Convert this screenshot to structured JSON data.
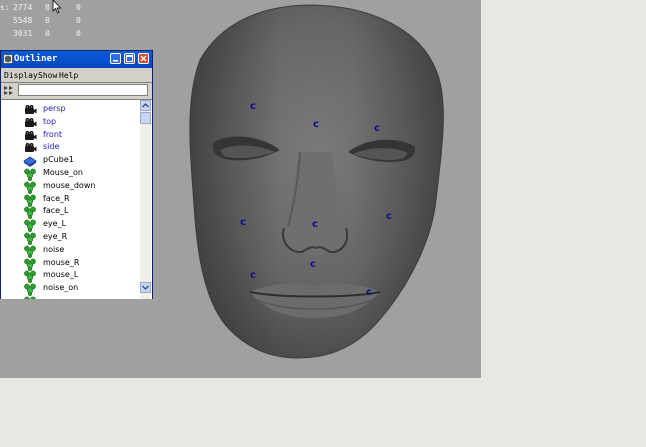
{
  "stats": {
    "rows": [
      [
        "s:",
        "2774",
        "0",
        "0"
      ],
      [
        "",
        "5548",
        "0",
        "0"
      ],
      [
        "",
        "3031",
        "0",
        "0"
      ]
    ]
  },
  "controls": [
    {
      "name": "ctrl-forehead-left",
      "label": "c"
    },
    {
      "name": "ctrl-forehead-center",
      "label": "c"
    },
    {
      "name": "ctrl-forehead-right",
      "label": "c"
    },
    {
      "name": "ctrl-cheek-left",
      "label": "c"
    },
    {
      "name": "ctrl-nose",
      "label": "c"
    },
    {
      "name": "ctrl-cheek-right",
      "label": "c"
    },
    {
      "name": "ctrl-upper-lip",
      "label": "c"
    },
    {
      "name": "ctrl-mouth-corner-left",
      "label": "c"
    },
    {
      "name": "ctrl-mouth-corner-right",
      "label": "c"
    }
  ],
  "outliner": {
    "title": "Outliner",
    "menu": [
      "Display",
      "Show",
      "Help"
    ],
    "items": [
      {
        "label": "persp",
        "icon": "camera-icon"
      },
      {
        "label": "top",
        "icon": "camera-icon"
      },
      {
        "label": "front",
        "icon": "camera-icon"
      },
      {
        "label": "side",
        "icon": "camera-icon"
      },
      {
        "label": "pCube1",
        "icon": "mesh-icon"
      },
      {
        "label": "Mouse_on",
        "icon": "cluster-icon"
      },
      {
        "label": "mouse_down",
        "icon": "cluster-icon"
      },
      {
        "label": "face_R",
        "icon": "cluster-icon"
      },
      {
        "label": "face_L",
        "icon": "cluster-icon"
      },
      {
        "label": "eye_L",
        "icon": "cluster-icon"
      },
      {
        "label": "eye_R",
        "icon": "cluster-icon"
      },
      {
        "label": "noise",
        "icon": "cluster-icon"
      },
      {
        "label": "mouse_R",
        "icon": "cluster-icon"
      },
      {
        "label": "mouse_L",
        "icon": "cluster-icon"
      },
      {
        "label": "noise_on",
        "icon": "cluster-icon"
      },
      {
        "label": "",
        "icon": "cluster-icon"
      }
    ]
  },
  "colors": {
    "viewport": "#a0a0a0",
    "titlebar": "#0a5cd7",
    "control_marker": "#0c0c8a"
  }
}
